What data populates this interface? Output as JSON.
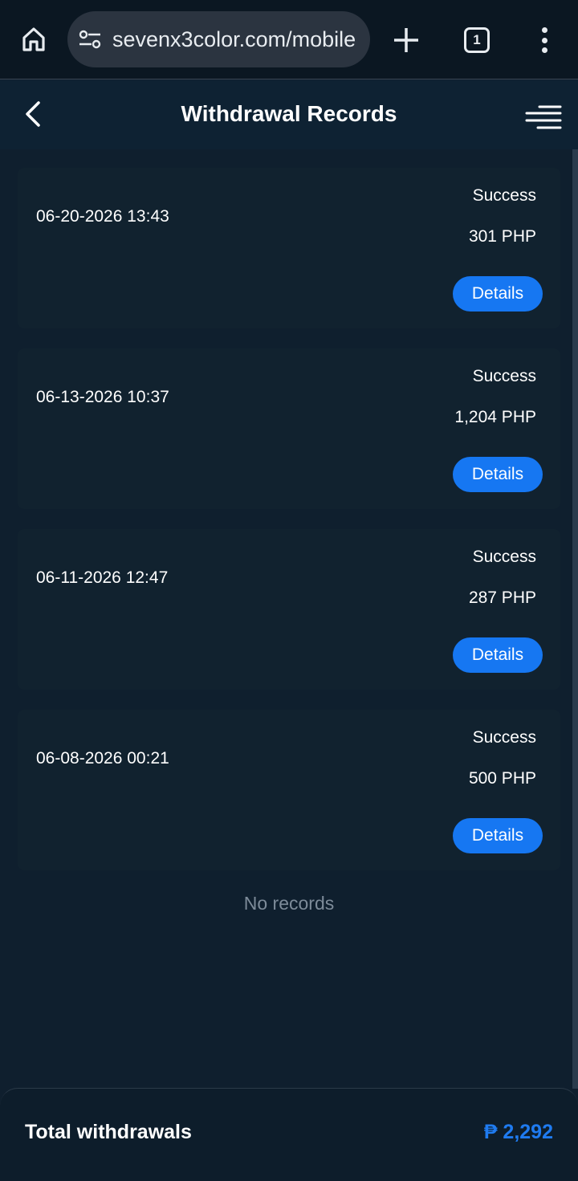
{
  "browser": {
    "url": "sevenx3color.com/mobile",
    "tab_count": "1"
  },
  "header": {
    "title": "Withdrawal Records"
  },
  "records": [
    {
      "date": "06-20-2026 13:43",
      "status": "Success",
      "amount": "301 PHP",
      "action": "Details"
    },
    {
      "date": "06-13-2026 10:37",
      "status": "Success",
      "amount": "1,204 PHP",
      "action": "Details"
    },
    {
      "date": "06-11-2026 12:47",
      "status": "Success",
      "amount": "287 PHP",
      "action": "Details"
    },
    {
      "date": "06-08-2026 00:21",
      "status": "Success",
      "amount": "500 PHP",
      "action": "Details"
    }
  ],
  "empty_text": "No records",
  "footer": {
    "label": "Total withdrawals",
    "total": "₱ 2,292"
  },
  "colors": {
    "background": "#0f1f2e",
    "card": "#11222f",
    "accent": "#1677f2",
    "total_text": "#1f7bf0"
  }
}
